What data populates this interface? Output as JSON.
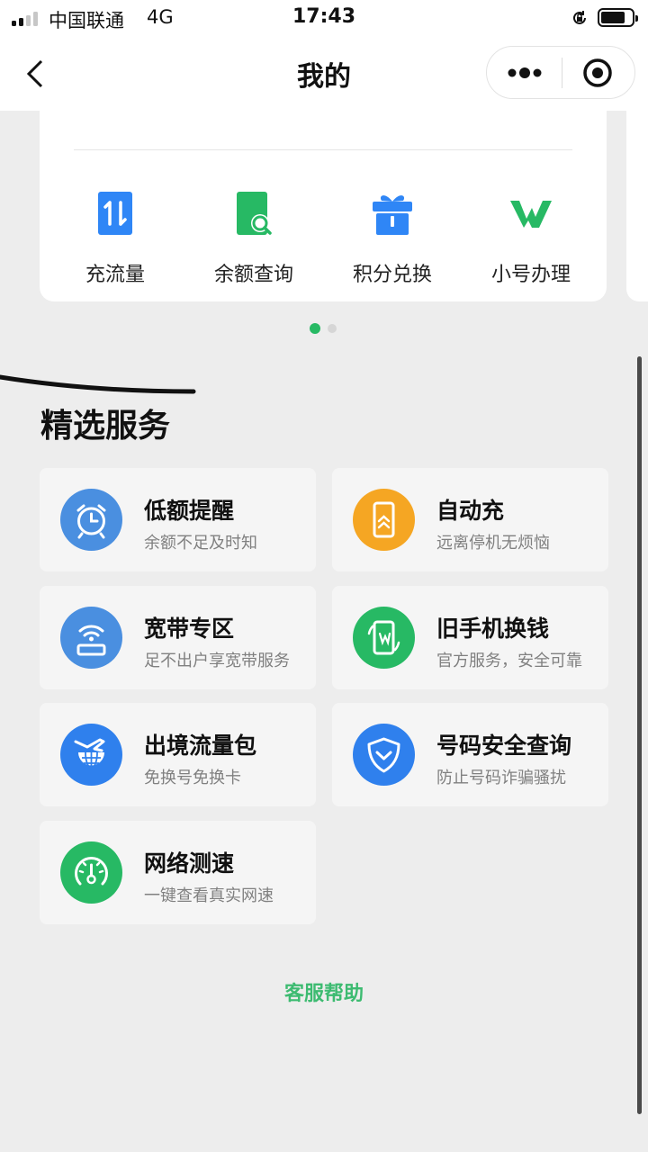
{
  "status_bar": {
    "carrier": "中国联通",
    "network": "4G",
    "time": "17:43",
    "battery_level": 0.8
  },
  "nav": {
    "title": "我的"
  },
  "quick_tools": [
    {
      "label": "充流量",
      "icon": "data-transfer-icon"
    },
    {
      "label": "余额查询",
      "icon": "balance-search-icon"
    },
    {
      "label": "积分兑换",
      "icon": "gift-icon"
    },
    {
      "label": "小号办理",
      "icon": "w-logo-icon"
    }
  ],
  "carousel": {
    "pages": 2,
    "active": 1
  },
  "services": {
    "title": "精选服务",
    "items": [
      {
        "name": "低额提醒",
        "desc": "余额不足及时知",
        "icon": "alarm-clock-icon",
        "color": "#4a8fe0"
      },
      {
        "name": "自动充",
        "desc": "远离停机无烦恼",
        "icon": "phone-charge-icon",
        "color": "#f5a623"
      },
      {
        "name": "宽带专区",
        "desc": "足不出户享宽带服务",
        "icon": "wifi-router-icon",
        "color": "#4a8fe0"
      },
      {
        "name": "旧手机换钱",
        "desc": "官方服务，安全可靠",
        "icon": "phone-recycle-icon",
        "color": "#27b964"
      },
      {
        "name": "出境流量包",
        "desc": "免换号免换卡",
        "icon": "plane-globe-icon",
        "color": "#2f80ed"
      },
      {
        "name": "号码安全查询",
        "desc": "防止号码诈骗骚扰",
        "icon": "shield-icon",
        "color": "#2f80ed"
      },
      {
        "name": "网络测速",
        "desc": "一键查看真实网速",
        "icon": "speedometer-icon",
        "color": "#27b964"
      }
    ]
  },
  "help": {
    "label": "客服帮助"
  },
  "colors": {
    "accent": "#3dbb71",
    "page_bg": "#ededed",
    "tool_blue": "#2f86f6",
    "tool_green": "#27b964"
  }
}
